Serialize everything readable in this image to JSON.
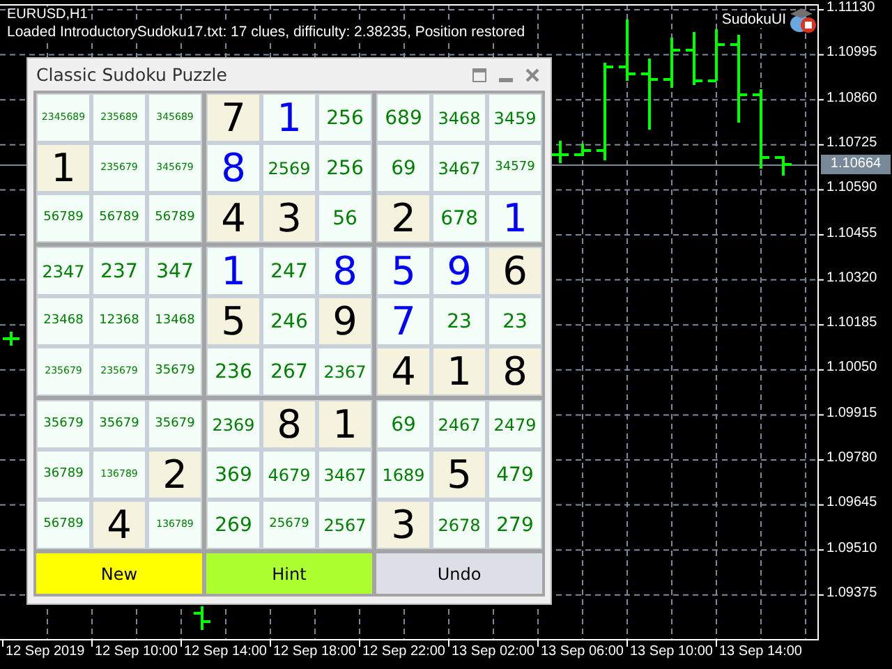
{
  "chart": {
    "symbol": "EURUSD,H1",
    "status": "Loaded IntroductorySudoku17.txt: 17 clues, difficulty: 2.38235, Position restored",
    "expert": "SudokuUI",
    "price_labels": [
      "1.11130",
      "1.10995",
      "1.10860",
      "1.10725",
      "1.10590",
      "1.10455",
      "1.10320",
      "1.10185",
      "1.10050",
      "1.09915",
      "1.09780",
      "1.09645",
      "1.09510",
      "1.09375"
    ],
    "current_price": "1.10664",
    "time_labels": [
      "12 Sep 2019",
      "12 Sep 10:00",
      "12 Sep 14:00",
      "12 Sep 18:00",
      "12 Sep 22:00",
      "13 Sep 02:00",
      "13 Sep 06:00",
      "13 Sep 10:00",
      "13 Sep 14:00"
    ]
  },
  "panel": {
    "title": "Classic Sudoku Puzzle",
    "rows": [
      [
        {
          "kind": "candidates",
          "text": "2345689"
        },
        {
          "kind": "candidates",
          "text": "235689"
        },
        {
          "kind": "candidates",
          "text": "345689"
        },
        {
          "kind": "given",
          "text": "7"
        },
        {
          "kind": "solved",
          "text": "1"
        },
        {
          "kind": "candidates",
          "text": "256"
        },
        {
          "kind": "candidates",
          "text": "689"
        },
        {
          "kind": "candidates",
          "text": "3468"
        },
        {
          "kind": "candidates",
          "text": "3459"
        }
      ],
      [
        {
          "kind": "given",
          "text": "1"
        },
        {
          "kind": "candidates",
          "text": "235679"
        },
        {
          "kind": "candidates",
          "text": "345679"
        },
        {
          "kind": "solved",
          "text": "8"
        },
        {
          "kind": "candidates",
          "text": "2569"
        },
        {
          "kind": "candidates",
          "text": "256"
        },
        {
          "kind": "candidates",
          "text": "69"
        },
        {
          "kind": "candidates",
          "text": "3467"
        },
        {
          "kind": "candidates",
          "text": "34579"
        }
      ],
      [
        {
          "kind": "candidates",
          "text": "56789"
        },
        {
          "kind": "candidates",
          "text": "56789"
        },
        {
          "kind": "candidates",
          "text": "56789"
        },
        {
          "kind": "given",
          "text": "4"
        },
        {
          "kind": "given",
          "text": "3"
        },
        {
          "kind": "candidates",
          "text": "56"
        },
        {
          "kind": "given",
          "text": "2"
        },
        {
          "kind": "candidates",
          "text": "678"
        },
        {
          "kind": "solved",
          "text": "1"
        }
      ],
      [
        {
          "kind": "candidates",
          "text": "2347"
        },
        {
          "kind": "candidates",
          "text": "237"
        },
        {
          "kind": "candidates",
          "text": "347"
        },
        {
          "kind": "solved",
          "text": "1"
        },
        {
          "kind": "candidates",
          "text": "247"
        },
        {
          "kind": "solved",
          "text": "8"
        },
        {
          "kind": "solved",
          "text": "5"
        },
        {
          "kind": "solved",
          "text": "9"
        },
        {
          "kind": "given",
          "text": "6"
        }
      ],
      [
        {
          "kind": "candidates",
          "text": "23468"
        },
        {
          "kind": "candidates",
          "text": "12368"
        },
        {
          "kind": "candidates",
          "text": "13468"
        },
        {
          "kind": "given",
          "text": "5"
        },
        {
          "kind": "candidates",
          "text": "246"
        },
        {
          "kind": "given",
          "text": "9"
        },
        {
          "kind": "solved",
          "text": "7"
        },
        {
          "kind": "candidates",
          "text": "23"
        },
        {
          "kind": "candidates",
          "text": "23"
        }
      ],
      [
        {
          "kind": "candidates",
          "text": "235679"
        },
        {
          "kind": "candidates",
          "text": "235679"
        },
        {
          "kind": "candidates",
          "text": "35679"
        },
        {
          "kind": "candidates",
          "text": "236"
        },
        {
          "kind": "candidates",
          "text": "267"
        },
        {
          "kind": "candidates",
          "text": "2367"
        },
        {
          "kind": "given",
          "text": "4"
        },
        {
          "kind": "given",
          "text": "1"
        },
        {
          "kind": "given",
          "text": "8"
        }
      ],
      [
        {
          "kind": "candidates",
          "text": "35679"
        },
        {
          "kind": "candidates",
          "text": "35679"
        },
        {
          "kind": "candidates",
          "text": "35679"
        },
        {
          "kind": "candidates",
          "text": "2369"
        },
        {
          "kind": "given",
          "text": "8"
        },
        {
          "kind": "given",
          "text": "1"
        },
        {
          "kind": "candidates",
          "text": "69"
        },
        {
          "kind": "candidates",
          "text": "2467"
        },
        {
          "kind": "candidates",
          "text": "2479"
        }
      ],
      [
        {
          "kind": "candidates",
          "text": "36789"
        },
        {
          "kind": "candidates",
          "text": "136789"
        },
        {
          "kind": "given",
          "text": "2"
        },
        {
          "kind": "candidates",
          "text": "369"
        },
        {
          "kind": "candidates",
          "text": "4679"
        },
        {
          "kind": "candidates",
          "text": "3467"
        },
        {
          "kind": "candidates",
          "text": "1689"
        },
        {
          "kind": "given",
          "text": "5"
        },
        {
          "kind": "candidates",
          "text": "479"
        }
      ],
      [
        {
          "kind": "candidates",
          "text": "56789"
        },
        {
          "kind": "given",
          "text": "4"
        },
        {
          "kind": "candidates",
          "text": "136789"
        },
        {
          "kind": "candidates",
          "text": "269"
        },
        {
          "kind": "candidates",
          "text": "25679"
        },
        {
          "kind": "candidates",
          "text": "2567"
        },
        {
          "kind": "given",
          "text": "3"
        },
        {
          "kind": "candidates",
          "text": "2678"
        },
        {
          "kind": "candidates",
          "text": "279"
        }
      ]
    ],
    "buttons": [
      {
        "label": "New",
        "color": "#ffff00"
      },
      {
        "label": "Hint",
        "color": "#adff2f"
      },
      {
        "label": "Undo",
        "color": "#dcdfe6"
      }
    ]
  }
}
